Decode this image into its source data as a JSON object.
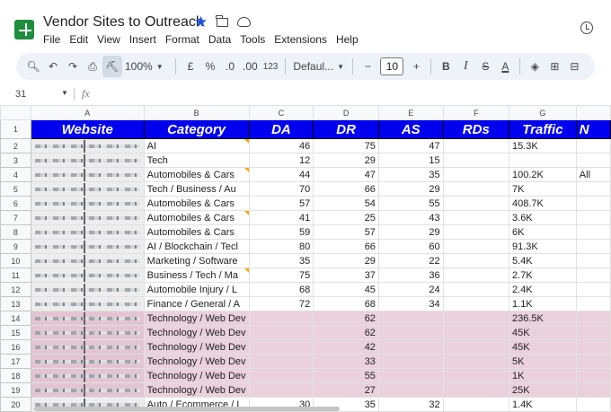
{
  "app": {
    "title": "Vendor Sites to Outreach",
    "menu": [
      "File",
      "Edit",
      "View",
      "Insert",
      "Format",
      "Data",
      "Tools",
      "Extensions",
      "Help"
    ]
  },
  "toolbar": {
    "zoom": "100%",
    "currency": "£",
    "percent": "%",
    "dec_decrease": ".0",
    "dec_increase": ".00",
    "number_format": "123",
    "font": "Defaul...",
    "font_size_minus": "−",
    "font_size": "10",
    "font_size_plus": "+",
    "bold": "B",
    "italic": "I",
    "strike": "S",
    "text_color": "A"
  },
  "formula_bar": {
    "name_box": "31",
    "fx": "fx"
  },
  "columns": [
    "A",
    "B",
    "C",
    "D",
    "E",
    "F",
    "G"
  ],
  "headers": [
    "Website",
    "Category",
    "DA",
    "DR",
    "AS",
    "RDs",
    "Traffic",
    "N"
  ],
  "rows": [
    {
      "n": "2",
      "cat": "AI",
      "da": "46",
      "dr": "75",
      "as": "47",
      "rds": "",
      "traffic": "15.3K",
      "h": "",
      "pink": false,
      "flag": true
    },
    {
      "n": "3",
      "cat": "Tech",
      "da": "12",
      "dr": "29",
      "as": "15",
      "rds": "",
      "traffic": "",
      "h": "",
      "pink": false,
      "flag": false
    },
    {
      "n": "4",
      "cat": "Automobiles & Cars",
      "da": "44",
      "dr": "47",
      "as": "35",
      "rds": "",
      "traffic": "100.2K",
      "h": "All",
      "pink": false,
      "flag": true
    },
    {
      "n": "5",
      "cat": "Tech / Business / Au",
      "da": "70",
      "dr": "66",
      "as": "29",
      "rds": "",
      "traffic": "7K",
      "h": "",
      "pink": false,
      "flag": false
    },
    {
      "n": "6",
      "cat": "Automobiles & Cars",
      "da": "57",
      "dr": "54",
      "as": "55",
      "rds": "",
      "traffic": "408.7K",
      "h": "",
      "pink": false,
      "flag": false
    },
    {
      "n": "7",
      "cat": "Automobiles & Cars",
      "da": "41",
      "dr": "25",
      "as": "43",
      "rds": "",
      "traffic": "3.6K",
      "h": "",
      "pink": false,
      "flag": true
    },
    {
      "n": "8",
      "cat": "Automobiles & Cars",
      "da": "59",
      "dr": "57",
      "as": "29",
      "rds": "",
      "traffic": "6K",
      "h": "",
      "pink": false,
      "flag": false
    },
    {
      "n": "9",
      "cat": "AI / Blockchain / Tecl",
      "da": "80",
      "dr": "66",
      "as": "60",
      "rds": "",
      "traffic": "91.3K",
      "h": "",
      "pink": false,
      "flag": false
    },
    {
      "n": "10",
      "cat": "Marketing / Software",
      "da": "35",
      "dr": "29",
      "as": "22",
      "rds": "",
      "traffic": "5.4K",
      "h": "",
      "pink": false,
      "flag": false
    },
    {
      "n": "11",
      "cat": "Business / Tech / Ma",
      "da": "75",
      "dr": "37",
      "as": "36",
      "rds": "",
      "traffic": "2.7K",
      "h": "",
      "pink": false,
      "flag": true
    },
    {
      "n": "12",
      "cat": "Automobile Injury / L",
      "da": "68",
      "dr": "45",
      "as": "24",
      "rds": "",
      "traffic": "2.4K",
      "h": "",
      "pink": false,
      "flag": false
    },
    {
      "n": "13",
      "cat": "Finance / General / A",
      "da": "72",
      "dr": "68",
      "as": "34",
      "rds": "",
      "traffic": "1.1K",
      "h": "",
      "pink": false,
      "flag": false
    },
    {
      "n": "14",
      "cat": "Technology / Web Dev",
      "da": "",
      "dr": "62",
      "as": "",
      "rds": "",
      "traffic": "236.5K",
      "h": "",
      "pink": true,
      "flag": false
    },
    {
      "n": "15",
      "cat": "Technology / Web Dev",
      "da": "",
      "dr": "62",
      "as": "",
      "rds": "",
      "traffic": "45K",
      "h": "",
      "pink": true,
      "flag": false
    },
    {
      "n": "16",
      "cat": "Technology / Web Dev",
      "da": "",
      "dr": "42",
      "as": "",
      "rds": "",
      "traffic": "45K",
      "h": "",
      "pink": true,
      "flag": false
    },
    {
      "n": "17",
      "cat": "Technology / Web Dev",
      "da": "",
      "dr": "33",
      "as": "",
      "rds": "",
      "traffic": "5K",
      "h": "",
      "pink": true,
      "flag": false
    },
    {
      "n": "18",
      "cat": "Technology / Web Dev",
      "da": "",
      "dr": "55",
      "as": "",
      "rds": "",
      "traffic": "1K",
      "h": "",
      "pink": true,
      "flag": false
    },
    {
      "n": "19",
      "cat": "Technology / Web Dev",
      "da": "",
      "dr": "27",
      "as": "",
      "rds": "",
      "traffic": "25K",
      "h": "",
      "pink": true,
      "flag": false
    },
    {
      "n": "20",
      "cat": "Auto / Ecommerce / L",
      "da": "30",
      "dr": "35",
      "as": "32",
      "rds": "",
      "traffic": "1.4K",
      "h": "",
      "pink": false,
      "flag": false
    }
  ]
}
